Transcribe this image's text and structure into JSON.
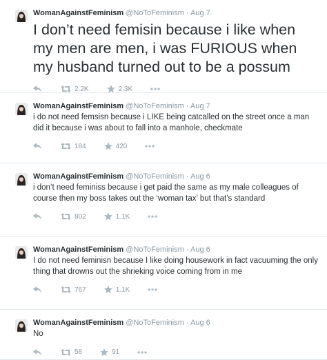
{
  "colors": {
    "text": "#292f33",
    "meta": "#8899a6",
    "icon": "#aab8c2",
    "divider": "#e1e8ed"
  },
  "tweets": [
    {
      "name": "WomanAgainstFeminism",
      "handle": "@NoToFeminism",
      "sep": "·",
      "date": "Aug 7",
      "text": "I don’t need femisin because i like when my men are men, i was FURIOUS when my husband turned out to be a possum",
      "retweets": "2.2K",
      "favorites": "2.3K",
      "icons": [
        "reply-icon",
        "retweet-icon",
        "favorite-icon",
        "more-icon"
      ]
    },
    {
      "name": "WomanAgainstFeminism",
      "handle": "@NoToFeminism",
      "sep": "·",
      "date": "Aug 7",
      "text": "i do not need femsisn because i LIKE being catcalled  on the street once a man did it because i was about to fall into a manhole, checkmate",
      "retweets": "184",
      "favorites": "420",
      "icons": [
        "reply-icon",
        "retweet-icon",
        "favorite-icon",
        "more-icon"
      ]
    },
    {
      "name": "WomanAgainstFeminism",
      "handle": "@NoToFeminism",
      "sep": "·",
      "date": "Aug 6",
      "text": "i don’t need feminiss because i get paid the same as my male colleagues of course then my boss takes out the ‘woman tax’ but that’s standard",
      "retweets": "802",
      "favorites": "1.1K",
      "icons": [
        "reply-icon",
        "retweet-icon",
        "favorite-icon",
        "more-icon"
      ]
    },
    {
      "name": "WomanAgainstFeminism",
      "handle": "@NoToFeminism",
      "sep": "·",
      "date": "Aug 6",
      "text": "I do not need feminisn because I like doing housework in fact vacuuming the only thing that drowns out the shrieking voice coming from in me",
      "retweets": "767",
      "favorites": "1.1K",
      "icons": [
        "reply-icon",
        "retweet-icon",
        "favorite-icon",
        "more-icon"
      ]
    },
    {
      "name": "WomanAgainstFeminism",
      "handle": "@NoToFeminism",
      "sep": "·",
      "date": "Aug 6",
      "text": "No",
      "retweets": "58",
      "favorites": "91",
      "icons": [
        "reply-icon",
        "retweet-icon",
        "favorite-icon",
        "more-icon"
      ]
    }
  ]
}
